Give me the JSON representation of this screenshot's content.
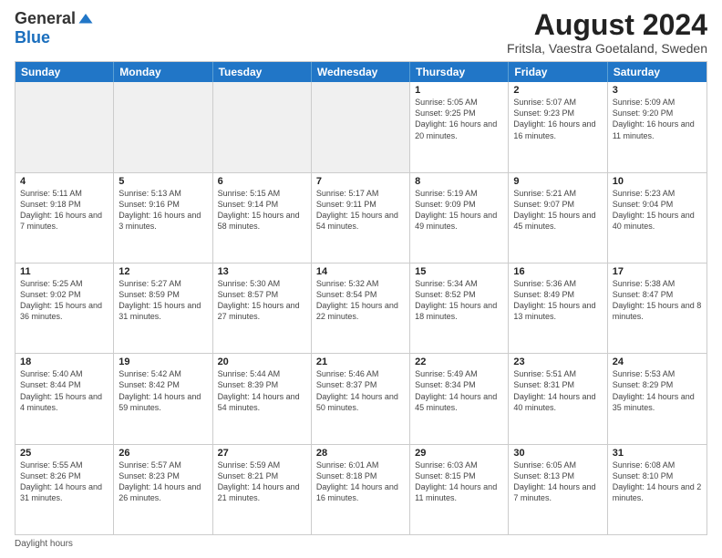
{
  "logo": {
    "general": "General",
    "blue": "Blue"
  },
  "title": {
    "month_year": "August 2024",
    "location": "Fritsla, Vaestra Goetaland, Sweden"
  },
  "calendar": {
    "headers": [
      "Sunday",
      "Monday",
      "Tuesday",
      "Wednesday",
      "Thursday",
      "Friday",
      "Saturday"
    ],
    "rows": [
      [
        {
          "day": "",
          "info": "",
          "shaded": true
        },
        {
          "day": "",
          "info": "",
          "shaded": true
        },
        {
          "day": "",
          "info": "",
          "shaded": true
        },
        {
          "day": "",
          "info": "",
          "shaded": true
        },
        {
          "day": "1",
          "info": "Sunrise: 5:05 AM\nSunset: 9:25 PM\nDaylight: 16 hours and 20 minutes.",
          "shaded": false
        },
        {
          "day": "2",
          "info": "Sunrise: 5:07 AM\nSunset: 9:23 PM\nDaylight: 16 hours and 16 minutes.",
          "shaded": false
        },
        {
          "day": "3",
          "info": "Sunrise: 5:09 AM\nSunset: 9:20 PM\nDaylight: 16 hours and 11 minutes.",
          "shaded": false
        }
      ],
      [
        {
          "day": "4",
          "info": "Sunrise: 5:11 AM\nSunset: 9:18 PM\nDaylight: 16 hours and 7 minutes.",
          "shaded": false
        },
        {
          "day": "5",
          "info": "Sunrise: 5:13 AM\nSunset: 9:16 PM\nDaylight: 16 hours and 3 minutes.",
          "shaded": false
        },
        {
          "day": "6",
          "info": "Sunrise: 5:15 AM\nSunset: 9:14 PM\nDaylight: 15 hours and 58 minutes.",
          "shaded": false
        },
        {
          "day": "7",
          "info": "Sunrise: 5:17 AM\nSunset: 9:11 PM\nDaylight: 15 hours and 54 minutes.",
          "shaded": false
        },
        {
          "day": "8",
          "info": "Sunrise: 5:19 AM\nSunset: 9:09 PM\nDaylight: 15 hours and 49 minutes.",
          "shaded": false
        },
        {
          "day": "9",
          "info": "Sunrise: 5:21 AM\nSunset: 9:07 PM\nDaylight: 15 hours and 45 minutes.",
          "shaded": false
        },
        {
          "day": "10",
          "info": "Sunrise: 5:23 AM\nSunset: 9:04 PM\nDaylight: 15 hours and 40 minutes.",
          "shaded": false
        }
      ],
      [
        {
          "day": "11",
          "info": "Sunrise: 5:25 AM\nSunset: 9:02 PM\nDaylight: 15 hours and 36 minutes.",
          "shaded": false
        },
        {
          "day": "12",
          "info": "Sunrise: 5:27 AM\nSunset: 8:59 PM\nDaylight: 15 hours and 31 minutes.",
          "shaded": false
        },
        {
          "day": "13",
          "info": "Sunrise: 5:30 AM\nSunset: 8:57 PM\nDaylight: 15 hours and 27 minutes.",
          "shaded": false
        },
        {
          "day": "14",
          "info": "Sunrise: 5:32 AM\nSunset: 8:54 PM\nDaylight: 15 hours and 22 minutes.",
          "shaded": false
        },
        {
          "day": "15",
          "info": "Sunrise: 5:34 AM\nSunset: 8:52 PM\nDaylight: 15 hours and 18 minutes.",
          "shaded": false
        },
        {
          "day": "16",
          "info": "Sunrise: 5:36 AM\nSunset: 8:49 PM\nDaylight: 15 hours and 13 minutes.",
          "shaded": false
        },
        {
          "day": "17",
          "info": "Sunrise: 5:38 AM\nSunset: 8:47 PM\nDaylight: 15 hours and 8 minutes.",
          "shaded": false
        }
      ],
      [
        {
          "day": "18",
          "info": "Sunrise: 5:40 AM\nSunset: 8:44 PM\nDaylight: 15 hours and 4 minutes.",
          "shaded": false
        },
        {
          "day": "19",
          "info": "Sunrise: 5:42 AM\nSunset: 8:42 PM\nDaylight: 14 hours and 59 minutes.",
          "shaded": false
        },
        {
          "day": "20",
          "info": "Sunrise: 5:44 AM\nSunset: 8:39 PM\nDaylight: 14 hours and 54 minutes.",
          "shaded": false
        },
        {
          "day": "21",
          "info": "Sunrise: 5:46 AM\nSunset: 8:37 PM\nDaylight: 14 hours and 50 minutes.",
          "shaded": false
        },
        {
          "day": "22",
          "info": "Sunrise: 5:49 AM\nSunset: 8:34 PM\nDaylight: 14 hours and 45 minutes.",
          "shaded": false
        },
        {
          "day": "23",
          "info": "Sunrise: 5:51 AM\nSunset: 8:31 PM\nDaylight: 14 hours and 40 minutes.",
          "shaded": false
        },
        {
          "day": "24",
          "info": "Sunrise: 5:53 AM\nSunset: 8:29 PM\nDaylight: 14 hours and 35 minutes.",
          "shaded": false
        }
      ],
      [
        {
          "day": "25",
          "info": "Sunrise: 5:55 AM\nSunset: 8:26 PM\nDaylight: 14 hours and 31 minutes.",
          "shaded": false
        },
        {
          "day": "26",
          "info": "Sunrise: 5:57 AM\nSunset: 8:23 PM\nDaylight: 14 hours and 26 minutes.",
          "shaded": false
        },
        {
          "day": "27",
          "info": "Sunrise: 5:59 AM\nSunset: 8:21 PM\nDaylight: 14 hours and 21 minutes.",
          "shaded": false
        },
        {
          "day": "28",
          "info": "Sunrise: 6:01 AM\nSunset: 8:18 PM\nDaylight: 14 hours and 16 minutes.",
          "shaded": false
        },
        {
          "day": "29",
          "info": "Sunrise: 6:03 AM\nSunset: 8:15 PM\nDaylight: 14 hours and 11 minutes.",
          "shaded": false
        },
        {
          "day": "30",
          "info": "Sunrise: 6:05 AM\nSunset: 8:13 PM\nDaylight: 14 hours and 7 minutes.",
          "shaded": false
        },
        {
          "day": "31",
          "info": "Sunrise: 6:08 AM\nSunset: 8:10 PM\nDaylight: 14 hours and 2 minutes.",
          "shaded": false
        }
      ]
    ]
  },
  "footer": {
    "note": "Daylight hours"
  }
}
